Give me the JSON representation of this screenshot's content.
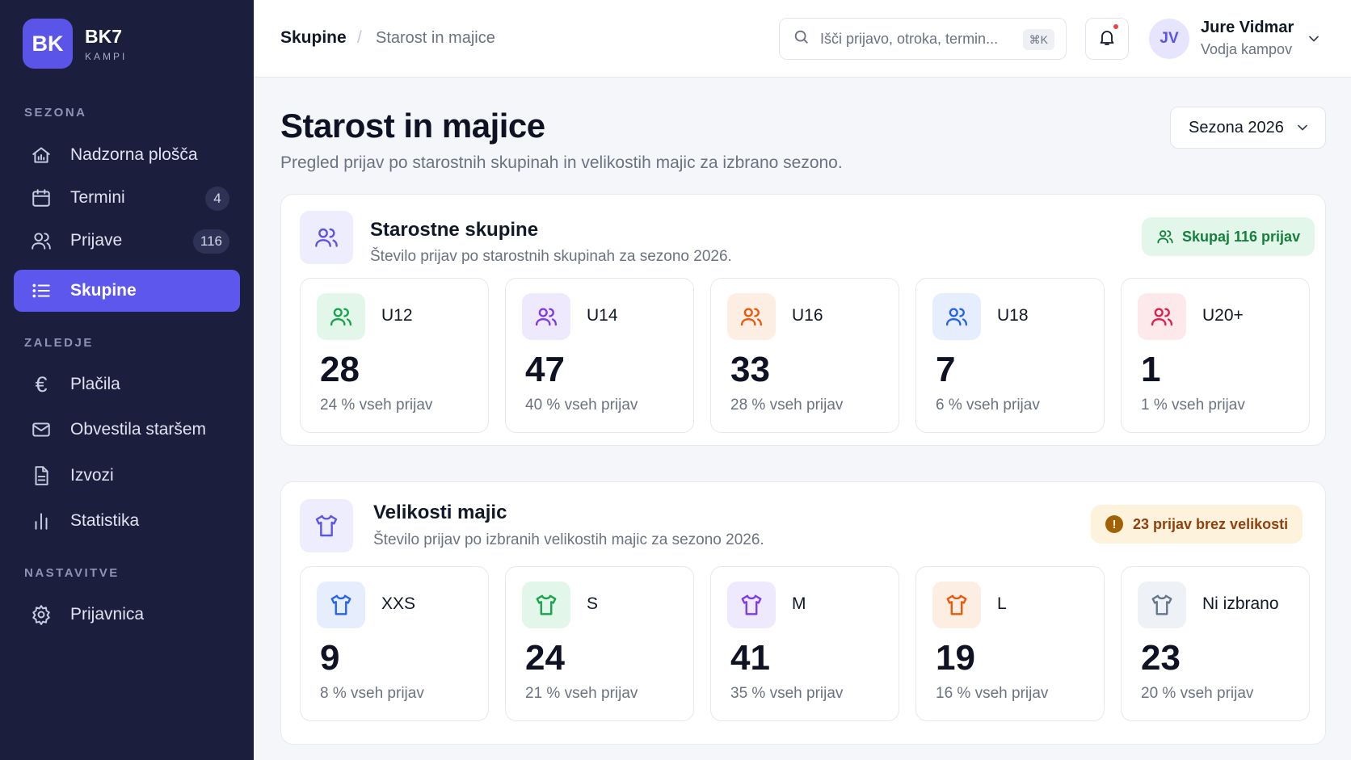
{
  "brand": {
    "logo": "BK",
    "name": "BK7",
    "sub": "KAMPI"
  },
  "sidebar": {
    "sections": [
      "SEZONA",
      "ZALEDJE",
      "NASTAVITVE"
    ],
    "items": [
      {
        "label": "Nadzorna plošča",
        "icon": "dashboard-home-icon"
      },
      {
        "label": "Termini",
        "icon": "calendar-icon",
        "badge": "4"
      },
      {
        "label": "Prijave",
        "icon": "users-icon",
        "badge": "116"
      },
      {
        "label": "Skupine",
        "icon": "list-icon",
        "active": true
      },
      {
        "label": "Plačila",
        "icon": "euro-icon",
        "glyph": "€"
      },
      {
        "label": "Obvestila staršem",
        "icon": "mail-icon"
      },
      {
        "label": "Izvozi",
        "icon": "document-icon"
      },
      {
        "label": "Statistika",
        "icon": "bar-chart-icon"
      },
      {
        "label": "Prijavnica",
        "icon": "gear-icon"
      }
    ]
  },
  "topbar": {
    "breadcrumb_current": "Skupine",
    "breadcrumb_sep": "/",
    "breadcrumb_page": "Starost in majice",
    "search_placeholder": "Išči prijavo, otroka, termin...",
    "search_shortcut": "⌘K",
    "user_initials": "JV",
    "user_name": "Jure Vidmar",
    "user_role": "Vodja kampov"
  },
  "page": {
    "title": "Starost in majice",
    "subtitle": "Pregled prijav po starostnih skupinah in velikostih majic za izbrano sezono.",
    "season": "Sezona 2026"
  },
  "age_panel": {
    "title": "Starostne skupine",
    "description": "Število prijav po starostnih skupinah za sezono 2026.",
    "pill": "Skupaj 116 prijav",
    "cards": [
      {
        "label": "U12",
        "value": "28",
        "note": "24 % vseh prijav",
        "color": "#16a34a",
        "bg": "#e3f6ea"
      },
      {
        "label": "U14",
        "value": "47",
        "note": "40 % vseh prijav",
        "color": "#7c3aed",
        "bg": "#efe9fd"
      },
      {
        "label": "U16",
        "value": "33",
        "note": "28 % vseh prijav",
        "color": "#ea580c",
        "bg": "#fdeee3"
      },
      {
        "label": "U18",
        "value": "7",
        "note": "6 % vseh prijav",
        "color": "#2563eb",
        "bg": "#e6edfd"
      },
      {
        "label": "U20+",
        "value": "1",
        "note": "1 % vseh prijav",
        "color": "#e11d48",
        "bg": "#fde8ec"
      }
    ]
  },
  "shirt_panel": {
    "title": "Velikosti majic",
    "description": "Število prijav po izbranih velikostih majic za sezono 2026.",
    "pill": "23 prijav brez velikosti",
    "pill_icon_glyph": "!",
    "cards": [
      {
        "label": "XXS",
        "value": "9",
        "note": "8 % vseh prijav",
        "color": "#2563eb",
        "bg": "#e6edfd"
      },
      {
        "label": "S",
        "value": "24",
        "note": "21 % vseh prijav",
        "color": "#16a34a",
        "bg": "#e3f6ea"
      },
      {
        "label": "M",
        "value": "41",
        "note": "35 % vseh prijav",
        "color": "#7c3aed",
        "bg": "#efe9fd"
      },
      {
        "label": "L",
        "value": "19",
        "note": "16 % vseh prijav",
        "color": "#ea580c",
        "bg": "#fdeee3"
      },
      {
        "label": "Ni izbrano",
        "value": "23",
        "note": "20 % vseh prijav",
        "color": "#64748b",
        "bg": "#eef1f5"
      }
    ]
  }
}
